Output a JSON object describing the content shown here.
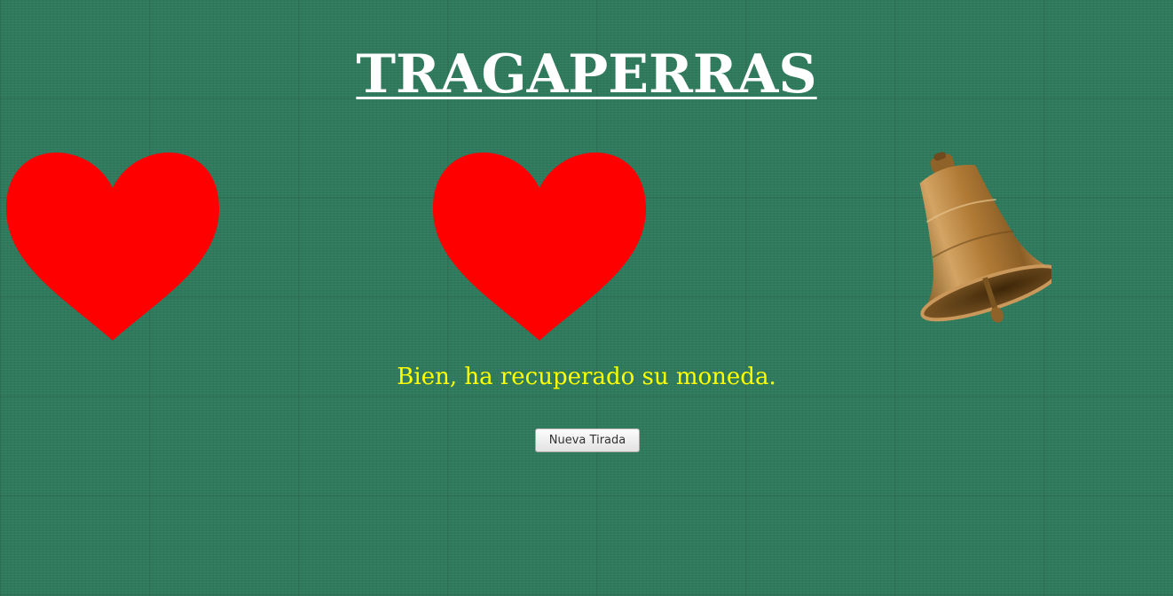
{
  "game": {
    "title": "TRAGAPERRAS",
    "reels": [
      {
        "symbol": "heart-icon",
        "color": "#ff0000"
      },
      {
        "symbol": "heart-icon",
        "color": "#ff0000"
      },
      {
        "symbol": "bell-icon",
        "color": "#b8863f"
      }
    ],
    "message": "Bien, ha recuperado su moneda.",
    "spin_button_label": "Nueva Tirada"
  },
  "colors": {
    "background": "#2f7a5c",
    "title": "#ffffff",
    "message": "#ffff00",
    "heart": "#ff0000"
  }
}
